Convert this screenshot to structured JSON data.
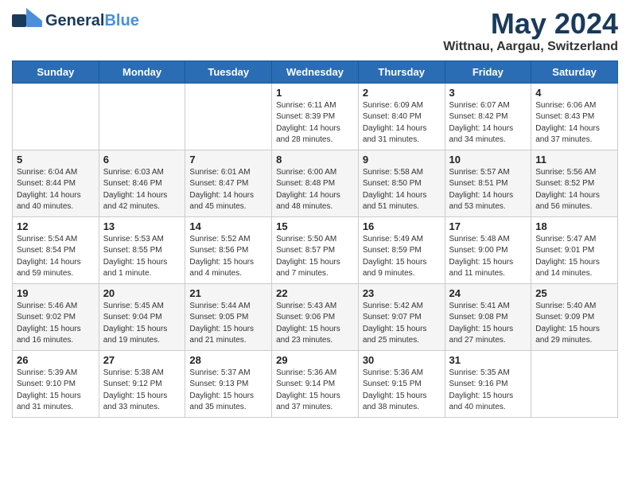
{
  "header": {
    "logo_line1": "General",
    "logo_line2": "Blue",
    "month": "May 2024",
    "location": "Wittnau, Aargau, Switzerland"
  },
  "days_of_week": [
    "Sunday",
    "Monday",
    "Tuesday",
    "Wednesday",
    "Thursday",
    "Friday",
    "Saturday"
  ],
  "weeks": [
    [
      {
        "day": "",
        "info": ""
      },
      {
        "day": "",
        "info": ""
      },
      {
        "day": "",
        "info": ""
      },
      {
        "day": "1",
        "info": "Sunrise: 6:11 AM\nSunset: 8:39 PM\nDaylight: 14 hours\nand 28 minutes."
      },
      {
        "day": "2",
        "info": "Sunrise: 6:09 AM\nSunset: 8:40 PM\nDaylight: 14 hours\nand 31 minutes."
      },
      {
        "day": "3",
        "info": "Sunrise: 6:07 AM\nSunset: 8:42 PM\nDaylight: 14 hours\nand 34 minutes."
      },
      {
        "day": "4",
        "info": "Sunrise: 6:06 AM\nSunset: 8:43 PM\nDaylight: 14 hours\nand 37 minutes."
      }
    ],
    [
      {
        "day": "5",
        "info": "Sunrise: 6:04 AM\nSunset: 8:44 PM\nDaylight: 14 hours\nand 40 minutes."
      },
      {
        "day": "6",
        "info": "Sunrise: 6:03 AM\nSunset: 8:46 PM\nDaylight: 14 hours\nand 42 minutes."
      },
      {
        "day": "7",
        "info": "Sunrise: 6:01 AM\nSunset: 8:47 PM\nDaylight: 14 hours\nand 45 minutes."
      },
      {
        "day": "8",
        "info": "Sunrise: 6:00 AM\nSunset: 8:48 PM\nDaylight: 14 hours\nand 48 minutes."
      },
      {
        "day": "9",
        "info": "Sunrise: 5:58 AM\nSunset: 8:50 PM\nDaylight: 14 hours\nand 51 minutes."
      },
      {
        "day": "10",
        "info": "Sunrise: 5:57 AM\nSunset: 8:51 PM\nDaylight: 14 hours\nand 53 minutes."
      },
      {
        "day": "11",
        "info": "Sunrise: 5:56 AM\nSunset: 8:52 PM\nDaylight: 14 hours\nand 56 minutes."
      }
    ],
    [
      {
        "day": "12",
        "info": "Sunrise: 5:54 AM\nSunset: 8:54 PM\nDaylight: 14 hours\nand 59 minutes."
      },
      {
        "day": "13",
        "info": "Sunrise: 5:53 AM\nSunset: 8:55 PM\nDaylight: 15 hours\nand 1 minute."
      },
      {
        "day": "14",
        "info": "Sunrise: 5:52 AM\nSunset: 8:56 PM\nDaylight: 15 hours\nand 4 minutes."
      },
      {
        "day": "15",
        "info": "Sunrise: 5:50 AM\nSunset: 8:57 PM\nDaylight: 15 hours\nand 7 minutes."
      },
      {
        "day": "16",
        "info": "Sunrise: 5:49 AM\nSunset: 8:59 PM\nDaylight: 15 hours\nand 9 minutes."
      },
      {
        "day": "17",
        "info": "Sunrise: 5:48 AM\nSunset: 9:00 PM\nDaylight: 15 hours\nand 11 minutes."
      },
      {
        "day": "18",
        "info": "Sunrise: 5:47 AM\nSunset: 9:01 PM\nDaylight: 15 hours\nand 14 minutes."
      }
    ],
    [
      {
        "day": "19",
        "info": "Sunrise: 5:46 AM\nSunset: 9:02 PM\nDaylight: 15 hours\nand 16 minutes."
      },
      {
        "day": "20",
        "info": "Sunrise: 5:45 AM\nSunset: 9:04 PM\nDaylight: 15 hours\nand 19 minutes."
      },
      {
        "day": "21",
        "info": "Sunrise: 5:44 AM\nSunset: 9:05 PM\nDaylight: 15 hours\nand 21 minutes."
      },
      {
        "day": "22",
        "info": "Sunrise: 5:43 AM\nSunset: 9:06 PM\nDaylight: 15 hours\nand 23 minutes."
      },
      {
        "day": "23",
        "info": "Sunrise: 5:42 AM\nSunset: 9:07 PM\nDaylight: 15 hours\nand 25 minutes."
      },
      {
        "day": "24",
        "info": "Sunrise: 5:41 AM\nSunset: 9:08 PM\nDaylight: 15 hours\nand 27 minutes."
      },
      {
        "day": "25",
        "info": "Sunrise: 5:40 AM\nSunset: 9:09 PM\nDaylight: 15 hours\nand 29 minutes."
      }
    ],
    [
      {
        "day": "26",
        "info": "Sunrise: 5:39 AM\nSunset: 9:10 PM\nDaylight: 15 hours\nand 31 minutes."
      },
      {
        "day": "27",
        "info": "Sunrise: 5:38 AM\nSunset: 9:12 PM\nDaylight: 15 hours\nand 33 minutes."
      },
      {
        "day": "28",
        "info": "Sunrise: 5:37 AM\nSunset: 9:13 PM\nDaylight: 15 hours\nand 35 minutes."
      },
      {
        "day": "29",
        "info": "Sunrise: 5:36 AM\nSunset: 9:14 PM\nDaylight: 15 hours\nand 37 minutes."
      },
      {
        "day": "30",
        "info": "Sunrise: 5:36 AM\nSunset: 9:15 PM\nDaylight: 15 hours\nand 38 minutes."
      },
      {
        "day": "31",
        "info": "Sunrise: 5:35 AM\nSunset: 9:16 PM\nDaylight: 15 hours\nand 40 minutes."
      },
      {
        "day": "",
        "info": ""
      }
    ]
  ]
}
